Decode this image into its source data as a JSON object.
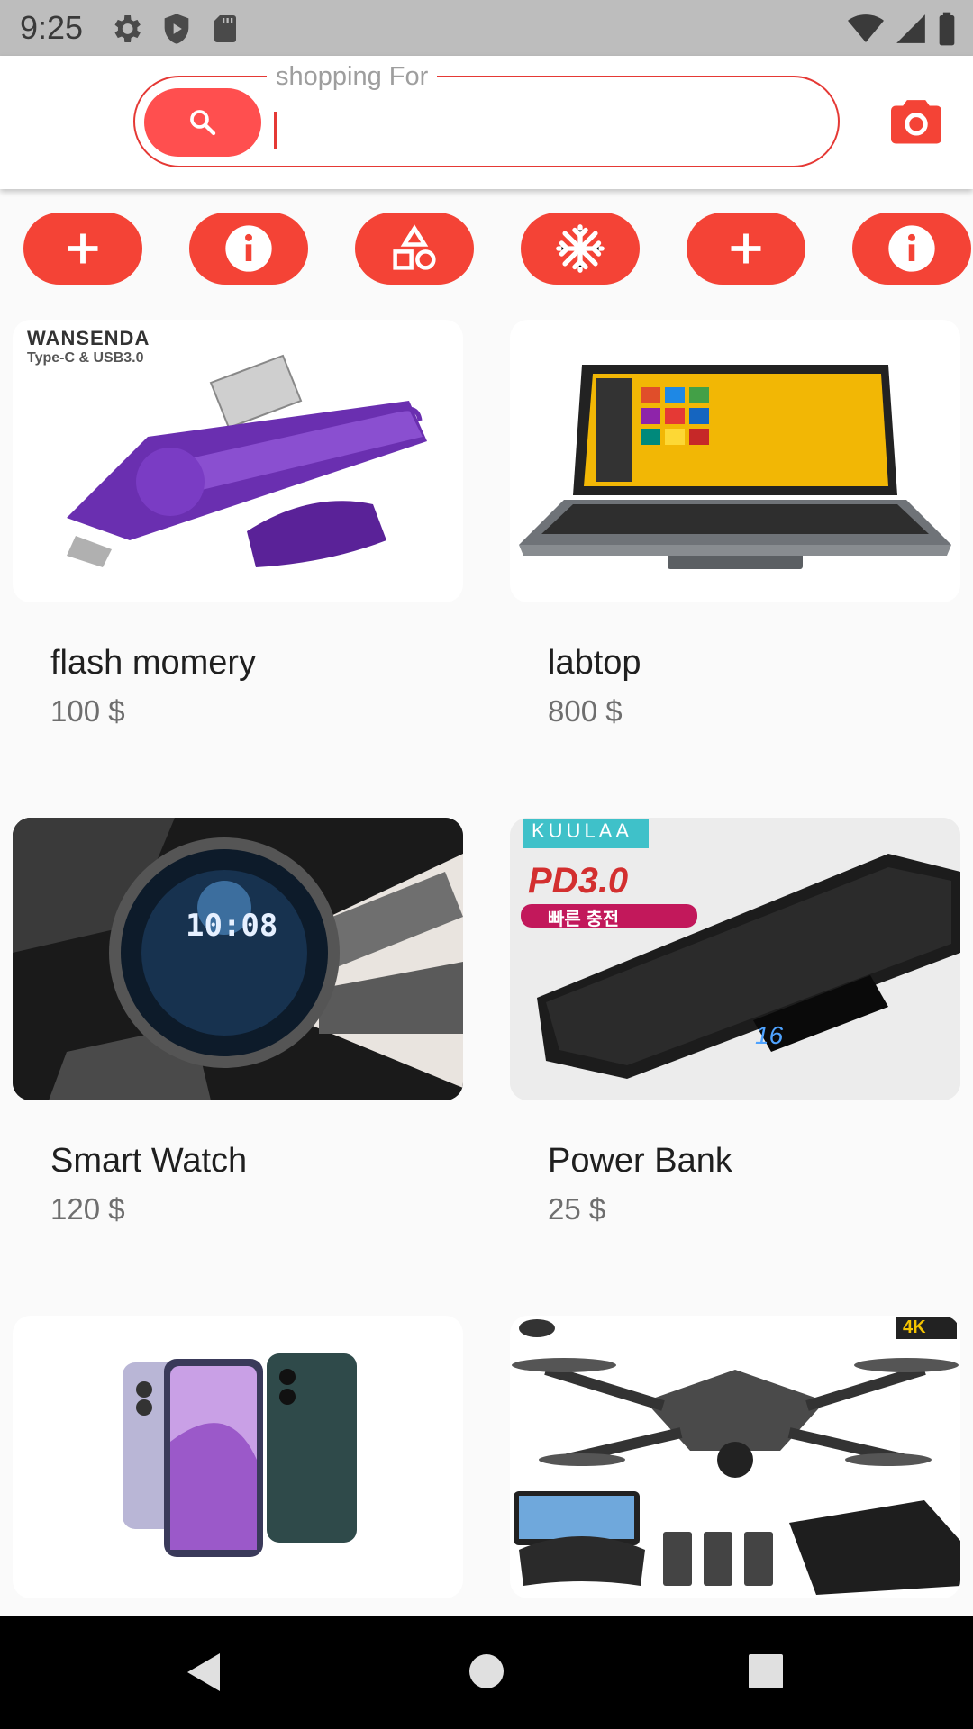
{
  "status_bar": {
    "time": "9:25",
    "left_icons": [
      "gear-icon",
      "shield-play-icon",
      "sd-card-icon"
    ],
    "right_icons": [
      "wifi-icon",
      "cell-signal-icon",
      "battery-icon"
    ]
  },
  "search": {
    "label": "shopping For",
    "value": "",
    "button_icon": "search-icon",
    "camera_icon": "camera-icon"
  },
  "categories": [
    {
      "icon": "plus-icon"
    },
    {
      "icon": "info-icon"
    },
    {
      "icon": "shapes-icon"
    },
    {
      "icon": "snowflake-icon"
    },
    {
      "icon": "plus-icon"
    },
    {
      "icon": "info-icon"
    }
  ],
  "products": [
    {
      "name": "flash momery",
      "price": "100 $",
      "image_text": "WANSENDA",
      "image_subtext": "Type-C & USB3.0"
    },
    {
      "name": " labtop",
      "price": "800 $"
    },
    {
      "name": "Smart Watch",
      "price": "120 $",
      "image_text": "10:08"
    },
    {
      "name": " Power Bank",
      "price": "25 $",
      "image_text": "KUULAA",
      "image_subtext": "PD3.0",
      "image_badge": "빠른 충전"
    },
    {
      "name": "",
      "price": ""
    },
    {
      "name": "",
      "price": "",
      "image_badge": "4K"
    }
  ],
  "colors": {
    "accent": "#f44336",
    "search_button": "#ff4f4f",
    "border": "#e53935"
  }
}
